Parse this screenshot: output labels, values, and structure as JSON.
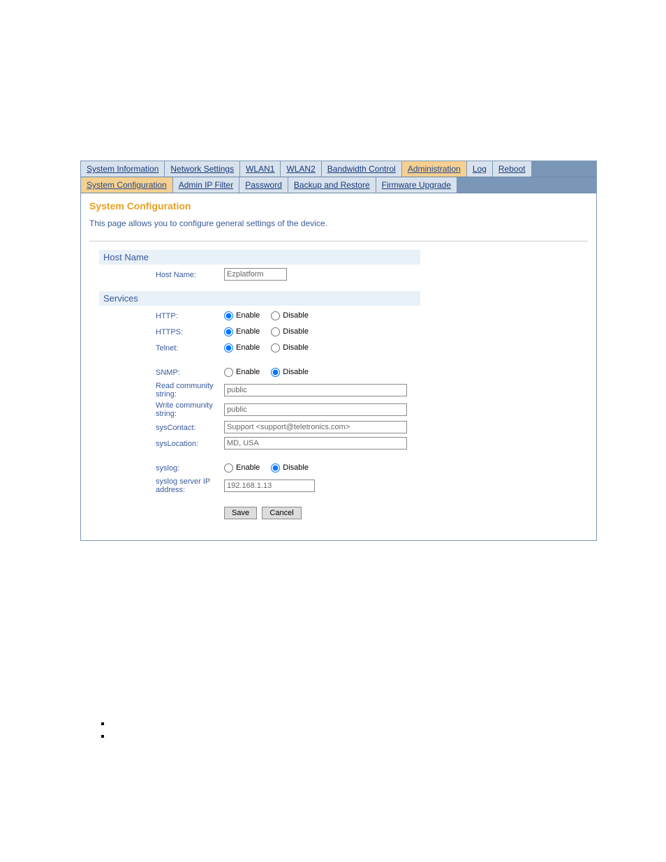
{
  "primary_tabs": {
    "system_information": "System Information",
    "network_settings": "Network Settings",
    "wlan1": "WLAN1",
    "wlan2": "WLAN2",
    "bandwidth_control": "Bandwidth Control",
    "administration": "Administration",
    "log": "Log",
    "reboot": "Reboot"
  },
  "secondary_tabs": {
    "system_configuration": "System Configuration",
    "admin_ip_filter": "Admin IP Filter",
    "password": "Password",
    "backup_and_restore": "Backup and Restore",
    "firmware_upgrade": "Firmware Upgrade"
  },
  "page": {
    "title": "System Configuration",
    "description": "This page allows you to configure general settings of the device."
  },
  "sections": {
    "host_name": "Host Name",
    "services": "Services"
  },
  "labels": {
    "host_name": "Host Name:",
    "http": "HTTP:",
    "https": "HTTPS:",
    "telnet": "Telnet:",
    "snmp": "SNMP:",
    "read_community": "Read community string:",
    "write_community": "Write community string:",
    "sys_contact": "sysContact:",
    "sys_location": "sysLocation:",
    "syslog": "syslog:",
    "syslog_server": "syslog server IP address:"
  },
  "radio": {
    "enable": "Enable",
    "disable": "Disable"
  },
  "values": {
    "host_name": "Ezplatform",
    "http": "enable",
    "https": "enable",
    "telnet": "enable",
    "snmp": "disable",
    "read_community": "public",
    "write_community": "public",
    "sys_contact": "Support <support@teletronics.com>",
    "sys_location": "MD, USA",
    "syslog": "disable",
    "syslog_server": "192.168.1.13"
  },
  "buttons": {
    "save": "Save",
    "cancel": "Cancel"
  }
}
